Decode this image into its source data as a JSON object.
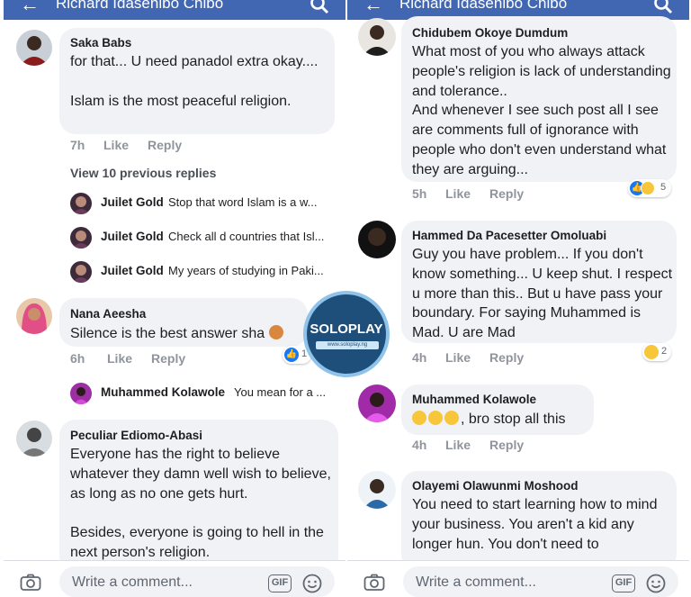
{
  "header": {
    "title": "Richard Idasenibo Chibo"
  },
  "left": {
    "comments": [
      {
        "name": "Saka Babs",
        "text": "for that... U need panadol extra okay....\n\nIslam is the most peaceful religion.",
        "time": "7h",
        "like": "Like",
        "reply": "Reply"
      },
      {
        "name": "Nana Aeesha",
        "text": "Silence is the best answer sha",
        "time": "6h",
        "like": "Like",
        "reply": "Reply",
        "reaction_count": "1"
      },
      {
        "name": "Peculiar Ediomo-Abasi",
        "text": "Everyone has the right to believe whatever they damn well wish to believe, as long as no one gets hurt.\n\nBesides, everyone is going to hell in the next person's religion."
      }
    ],
    "view_previous": "View 10 previous replies",
    "replies": [
      {
        "name": "Juilet Gold",
        "text": "Stop that word Islam is a w..."
      },
      {
        "name": "Juilet Gold",
        "text": "Check all d countries that Isl..."
      },
      {
        "name": "Juilet Gold",
        "text": "My years of studying in Paki..."
      }
    ],
    "reply2": {
      "name": "Muhammed Kolawole",
      "text": "You mean for a ..."
    }
  },
  "right": {
    "comments": [
      {
        "name": "Chidubem Okoye Dumdum",
        "text": "What most of you who always attack people's religion is lack of understanding and tolerance..\nAnd whenever I see such post all I see are comments full of ignorance with people who don't even understand what they are arguing...",
        "time": "5h",
        "like": "Like",
        "reply": "Reply",
        "reaction_count": "5"
      },
      {
        "name": "Hammed Da Pacesetter Omoluabi",
        "text": "Guy you have problem... If you don't know something... U keep shut. I respect u more than this.. But u have pass your boundary. For saying Muhammed is Mad. U are Mad",
        "time": "4h",
        "like": "Like",
        "reply": "Reply",
        "reaction_count": "2"
      },
      {
        "name": "Muhammed Kolawole",
        "text": ", bro stop all this",
        "time": "4h",
        "like": "Like",
        "reply": "Reply"
      },
      {
        "name": "Olayemi Olawunmi Moshood",
        "text": "You need to start learning how to mind your business. You aren't a kid any longer hun. You don't need to"
      }
    ]
  },
  "composer": {
    "placeholder": "Write a comment...",
    "gif_label": "GIF"
  },
  "watermark": {
    "brand": "SOLOPLAY",
    "sub": "www.soloplay.ng"
  },
  "colors": {
    "header": "#4267b2",
    "bubble": "#f0f2f5",
    "meta": "#90949c",
    "like_blue": "#1877f2",
    "haha_yellow": "#f7c63b"
  }
}
